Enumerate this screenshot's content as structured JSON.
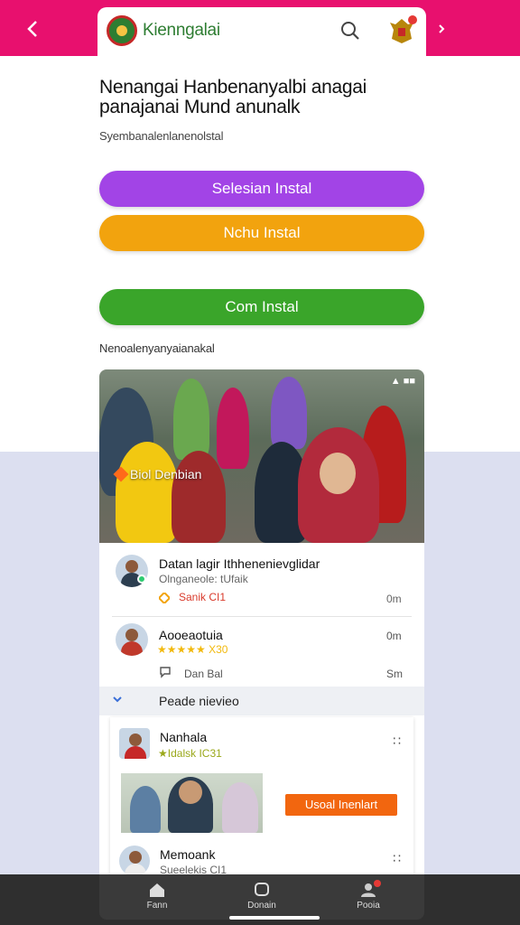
{
  "header": {
    "app_title": "Kienngalai"
  },
  "main": {
    "headline": "Nenangai Hanbenanyalbi anagai panajanai Mund anunalk",
    "subline": "Syembanalenlanenolstal",
    "buttons": {
      "primary": "Selesian Instal",
      "secondary": "Nchu Instal",
      "tertiary": "Com Instal"
    },
    "section_label": "Nenoalenyanyaianakal"
  },
  "feed": {
    "photo_badge": "▲ ■■",
    "photo_tag": "Biol Denbian",
    "post1": {
      "title": "Datan lagir Ithhenenievglidar",
      "subtitle": "Olnganeole: tUfaik",
      "meta": "Sanik CI1",
      "time": "0m"
    },
    "post2": {
      "title": "Aooeaotuia",
      "rating": "★★★★★ X30",
      "time": "0m",
      "meta": "Dan Bal",
      "time2": "Sm"
    },
    "subsection": {
      "title": "Peade nievieo"
    },
    "card1": {
      "title": "Nanhala",
      "rating": "★Idalsk IC31",
      "action": "Usoal Inenlart"
    },
    "card2": {
      "title": "Memoank",
      "subtitle": "Sueelekis CI1"
    }
  },
  "bottom_nav": {
    "items": [
      "Fann",
      "Donain",
      "Pooia"
    ]
  },
  "colors": {
    "brand_pink": "#e8106e",
    "button_purple": "#a244e6",
    "button_orange": "#f2a30e",
    "button_green": "#3aa52a",
    "action_orange": "#f2660f"
  }
}
